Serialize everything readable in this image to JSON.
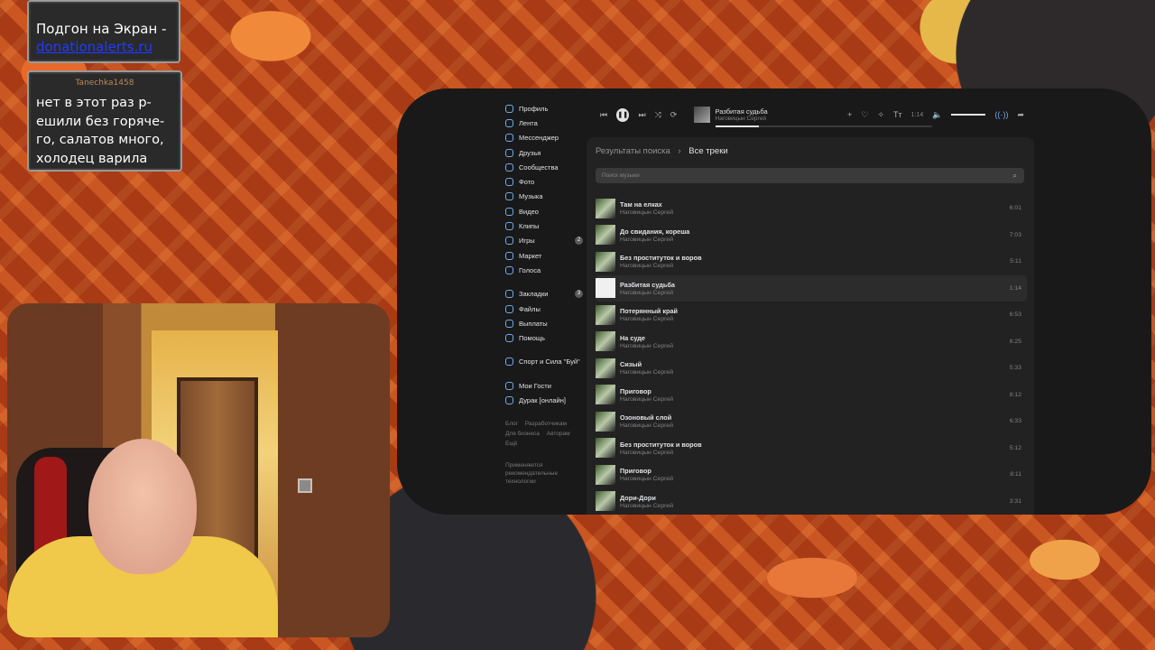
{
  "overlay": {
    "promo_text": "Подгон на Экран -",
    "promo_link": "donationalerts.ru",
    "chat_username": "Tanechka1458",
    "chat_message": "нет в этот раз р-ешили без горяче-го, салатов много, холодец варила"
  },
  "sidebar": {
    "items": [
      {
        "label": "Профиль",
        "icon": "profile-icon"
      },
      {
        "label": "Лента",
        "icon": "feed-icon"
      },
      {
        "label": "Мессенджер",
        "icon": "messenger-icon"
      },
      {
        "label": "Друзья",
        "icon": "friends-icon"
      },
      {
        "label": "Сообщества",
        "icon": "communities-icon"
      },
      {
        "label": "Фото",
        "icon": "photo-icon"
      },
      {
        "label": "Музыка",
        "icon": "music-icon"
      },
      {
        "label": "Видео",
        "icon": "video-icon"
      },
      {
        "label": "Клипы",
        "icon": "clips-icon"
      },
      {
        "label": "Игры",
        "icon": "games-icon",
        "badge": "2"
      },
      {
        "label": "Маркет",
        "icon": "market-icon"
      },
      {
        "label": "Голоса",
        "icon": "votes-icon"
      }
    ],
    "items2": [
      {
        "label": "Закладки",
        "icon": "bookmarks-icon",
        "badge": "3"
      },
      {
        "label": "Файлы",
        "icon": "files-icon"
      },
      {
        "label": "Выплаты",
        "icon": "payouts-icon"
      },
      {
        "label": "Помощь",
        "icon": "help-icon"
      }
    ],
    "group_item": "Спорт и Сила \"Буй\"",
    "apps": [
      {
        "label": "Мои Гости",
        "icon": "apps-icon"
      },
      {
        "label": "Дурак [онлайн]",
        "icon": "game-pad-icon"
      }
    ],
    "footer_links": [
      "Блог",
      "Разработчикам",
      "Для бизнеса",
      "Авторам",
      "Ещё"
    ],
    "footer_note": "Применяются рекомендательные технологии"
  },
  "player": {
    "title": "Разбитая судьба",
    "artist": "Наговицын Сергей",
    "time": "1:14",
    "progress": 0.2,
    "volume": 0.8
  },
  "content": {
    "breadcrumb_parent": "Результаты поиска",
    "breadcrumb_current": "Все треки",
    "search_placeholder": "Поиск музыки",
    "tracks": [
      {
        "title": "Там на елках",
        "artist": "Наговицын Сергей",
        "duration": "6:01"
      },
      {
        "title": "До свидания, кореша",
        "artist": "Наговицын Сергей",
        "duration": "7:03"
      },
      {
        "title": "Без проституток и воров",
        "artist": "Наговицын Сергей",
        "duration": "5:11"
      },
      {
        "title": "Разбитая судьба",
        "artist": "Наговицын Сергей",
        "duration": "1:14",
        "active": true
      },
      {
        "title": "Потерянный край",
        "artist": "Наговицын Сергей",
        "duration": "6:53"
      },
      {
        "title": "На суде",
        "artist": "Наговицын Сергей",
        "duration": "6:25"
      },
      {
        "title": "Сизый",
        "artist": "Наговицын Сергей",
        "duration": "5:33"
      },
      {
        "title": "Приговор",
        "artist": "Наговицын Сергей",
        "duration": "8:12"
      },
      {
        "title": "Озоновый слой",
        "artist": "Наговицын Сергей",
        "duration": "6:33"
      },
      {
        "title": "Без проституток и воров",
        "artist": "Наговицын Сергей",
        "duration": "5:12"
      },
      {
        "title": "Приговор",
        "artist": "Наговицын Сергей",
        "duration": "8:11"
      },
      {
        "title": "Дори-Дори",
        "artist": "Наговицын Сергей",
        "duration": "3:31"
      }
    ]
  }
}
